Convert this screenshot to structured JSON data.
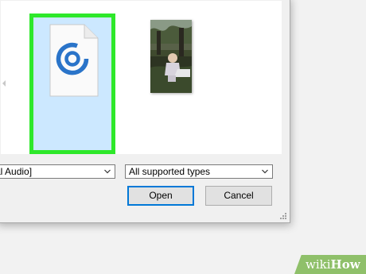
{
  "file_dialog": {
    "files": [
      {
        "kind": "audio-document",
        "selected": true,
        "icon": "groove-music-icon"
      },
      {
        "kind": "photo",
        "selected": false
      }
    ],
    "filename_select": {
      "value": "al Audio]"
    },
    "type_select": {
      "value": "All supported types"
    },
    "buttons": {
      "open_label": "Open",
      "cancel_label": "Cancel"
    }
  },
  "watermark": {
    "prefix": "wiki",
    "suffix": "How"
  },
  "colors": {
    "selection_fill": "#cce8ff",
    "highlight_border": "#2ee82a",
    "icon_blue": "#2a74c9",
    "watermark_green": "#8fc06a"
  }
}
